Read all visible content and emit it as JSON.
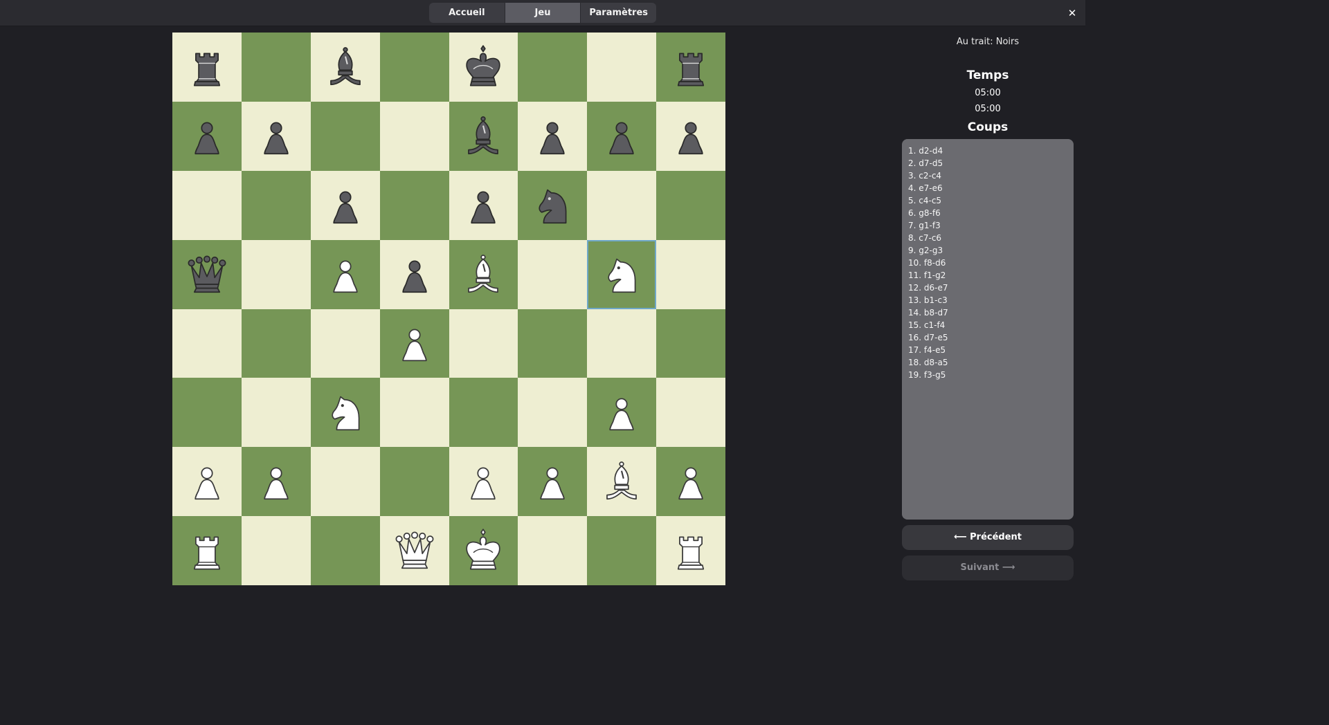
{
  "tabs": [
    {
      "label": "Accueil",
      "active": false
    },
    {
      "label": "Jeu",
      "active": true
    },
    {
      "label": "Paramètres",
      "active": false
    }
  ],
  "close_label": "✕",
  "board": {
    "light_color": "#eeeed2",
    "dark_color": "#769656",
    "selected_square": "g5",
    "ranks": [
      [
        "br",
        "",
        "bb",
        "",
        "bk",
        "",
        "",
        "br"
      ],
      [
        "bp",
        "bp",
        "",
        "",
        "bb",
        "bp",
        "bp",
        "bp"
      ],
      [
        "",
        "",
        "bp",
        "",
        "bp",
        "bn",
        "",
        ""
      ],
      [
        "bq",
        "",
        "wp",
        "bp",
        "wb",
        "",
        "wn",
        ""
      ],
      [
        "",
        "",
        "",
        "wp",
        "",
        "",
        "",
        ""
      ],
      [
        "",
        "",
        "wn",
        "",
        "",
        "",
        "wp",
        ""
      ],
      [
        "wp",
        "wp",
        "",
        "",
        "wp",
        "wp",
        "wb",
        "wp"
      ],
      [
        "wr",
        "",
        "",
        "wq",
        "wk",
        "",
        "",
        "wr"
      ]
    ]
  },
  "sidebar": {
    "turn": "Au trait: Noirs",
    "time_title": "Temps",
    "clock_white": "05:00",
    "clock_black": "05:00",
    "moves_title": "Coups",
    "moves": [
      "1. d2-d4",
      "2. d7-d5",
      "3. c2-c4",
      "4. e7-e6",
      "5. c4-c5",
      "6. g8-f6",
      "7. g1-f3",
      "8. c7-c6",
      "9. g2-g3",
      "10. f8-d6",
      "11. f1-g2",
      "12. d6-e7",
      "13. b1-c3",
      "14. b8-d7",
      "15. c1-f4",
      "16. d7-e5",
      "17. f4-e5",
      "18. d8-a5",
      "19. f3-g5"
    ],
    "prev_label": "⟵ Précédent",
    "next_label": "Suivant ⟶"
  }
}
